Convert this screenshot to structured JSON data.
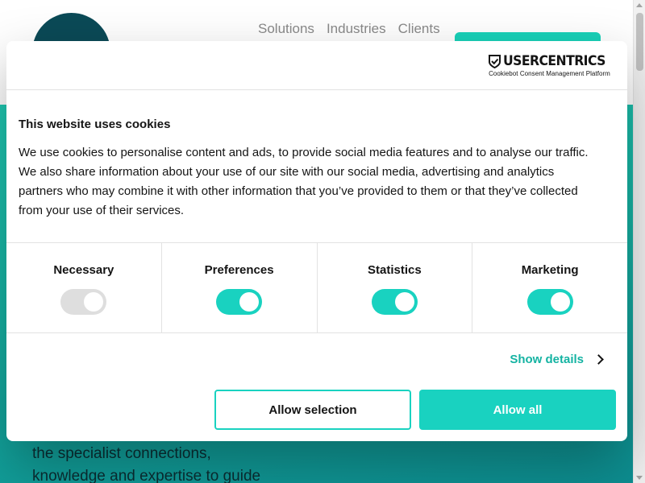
{
  "site": {
    "nav": [
      "Solutions",
      "Industries",
      "Clients"
    ],
    "hero_lines": [
      "the specialist connections,",
      "knowledge and expertise to guide"
    ]
  },
  "dialog": {
    "brand": {
      "name": "USERCENTRICS",
      "subtitle": "Cookiebot Consent Management Platform"
    },
    "title": "This website uses cookies",
    "description": "We use cookies to personalise content and ads, to provide social media features and to analyse our traffic. We also share information about your use of our site with our social media, advertising and analytics partners who may combine it with other information that you’ve provided to them or that they’ve collected from your use of their services.",
    "categories": [
      {
        "label": "Necessary",
        "checked": true,
        "disabled": true
      },
      {
        "label": "Preferences",
        "checked": true,
        "disabled": false
      },
      {
        "label": "Statistics",
        "checked": true,
        "disabled": false
      },
      {
        "label": "Marketing",
        "checked": true,
        "disabled": false
      }
    ],
    "show_details": "Show details",
    "buttons": {
      "allow_selection": "Allow selection",
      "allow_all": "Allow all"
    }
  },
  "colors": {
    "accent": "#19d2c0",
    "link": "#14b3a2",
    "logo": "#0b4a57",
    "text": "#141414"
  }
}
